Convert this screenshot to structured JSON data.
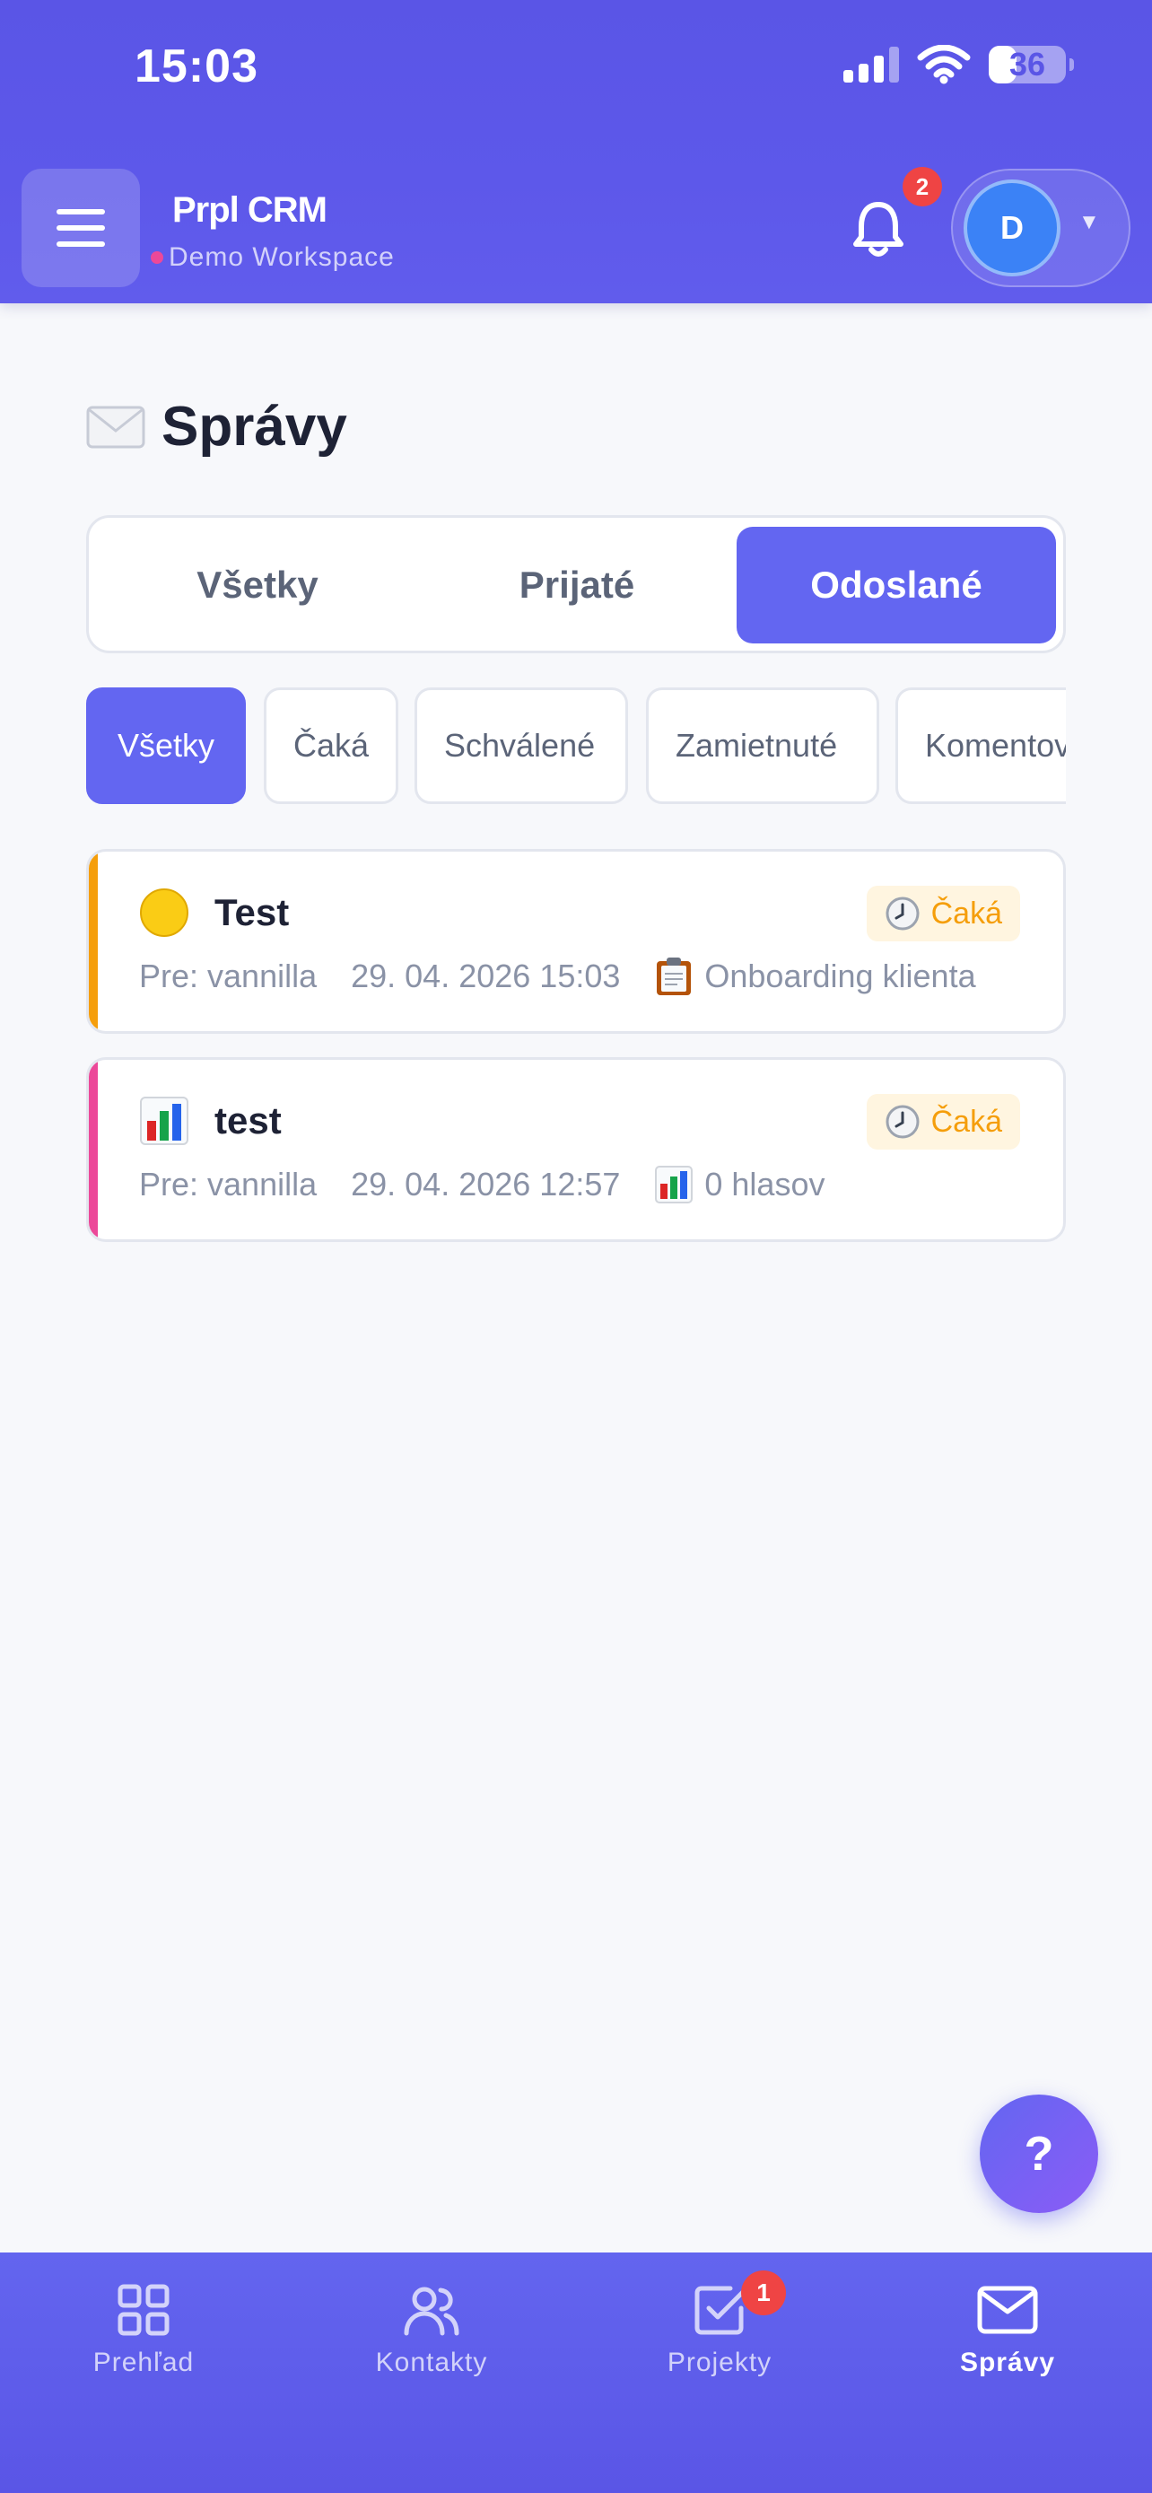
{
  "status_bar": {
    "time": "15:03",
    "battery": "36",
    "battery_level": 0.36
  },
  "header": {
    "app_name": "Prpl CRM",
    "workspace": "Demo Workspace",
    "notification_count": "2",
    "avatar_initial": "D",
    "icons": [
      "hamburger-menu-icon",
      "bell-icon",
      "caret-down-icon"
    ]
  },
  "page": {
    "title": "Správy",
    "title_icon": "envelope-emoji"
  },
  "tabs": [
    {
      "label": "Všetky",
      "active": false
    },
    {
      "label": "Prijaté",
      "active": false
    },
    {
      "label": "Odoslané",
      "active": true
    }
  ],
  "filters": [
    {
      "label": "Všetky",
      "active": true
    },
    {
      "label": "Čaká",
      "active": false
    },
    {
      "label": "Schválené",
      "active": false
    },
    {
      "label": "Zamietnuté",
      "active": false
    },
    {
      "label": "Komentov",
      "active": false
    }
  ],
  "messages": [
    {
      "icon": "yellow-circle-emoji",
      "title": "Test",
      "recipient": "Pre: vannilla",
      "date": "29. 04. 2026 15:03",
      "context_icon": "clipboard-emoji",
      "context": "Onboarding klienta",
      "status": "Čaká",
      "accent_color": "#f59e0b"
    },
    {
      "icon": "bar-chart-emoji",
      "title": "test",
      "recipient": "Pre: vannilla",
      "date": "29. 04. 2026 12:57",
      "context_icon": "bar-chart-emoji",
      "context": "0 hlasov",
      "status": "Čaká",
      "accent_color": "#ec4899"
    }
  ],
  "fab": {
    "label": "?"
  },
  "bottom_nav": [
    {
      "label": "Prehľad",
      "icon": "grid-icon",
      "active": false
    },
    {
      "label": "Kontakty",
      "icon": "users-icon",
      "active": false
    },
    {
      "label": "Projekty",
      "icon": "checkbox-icon",
      "badge": "1",
      "active": false
    },
    {
      "label": "Správy",
      "icon": "mail-icon",
      "active": true
    }
  ],
  "colors": {
    "primary": "#6366f1",
    "badge": "#ef4444",
    "pending": "#f59e0b",
    "avatar": "#3b82f6"
  }
}
